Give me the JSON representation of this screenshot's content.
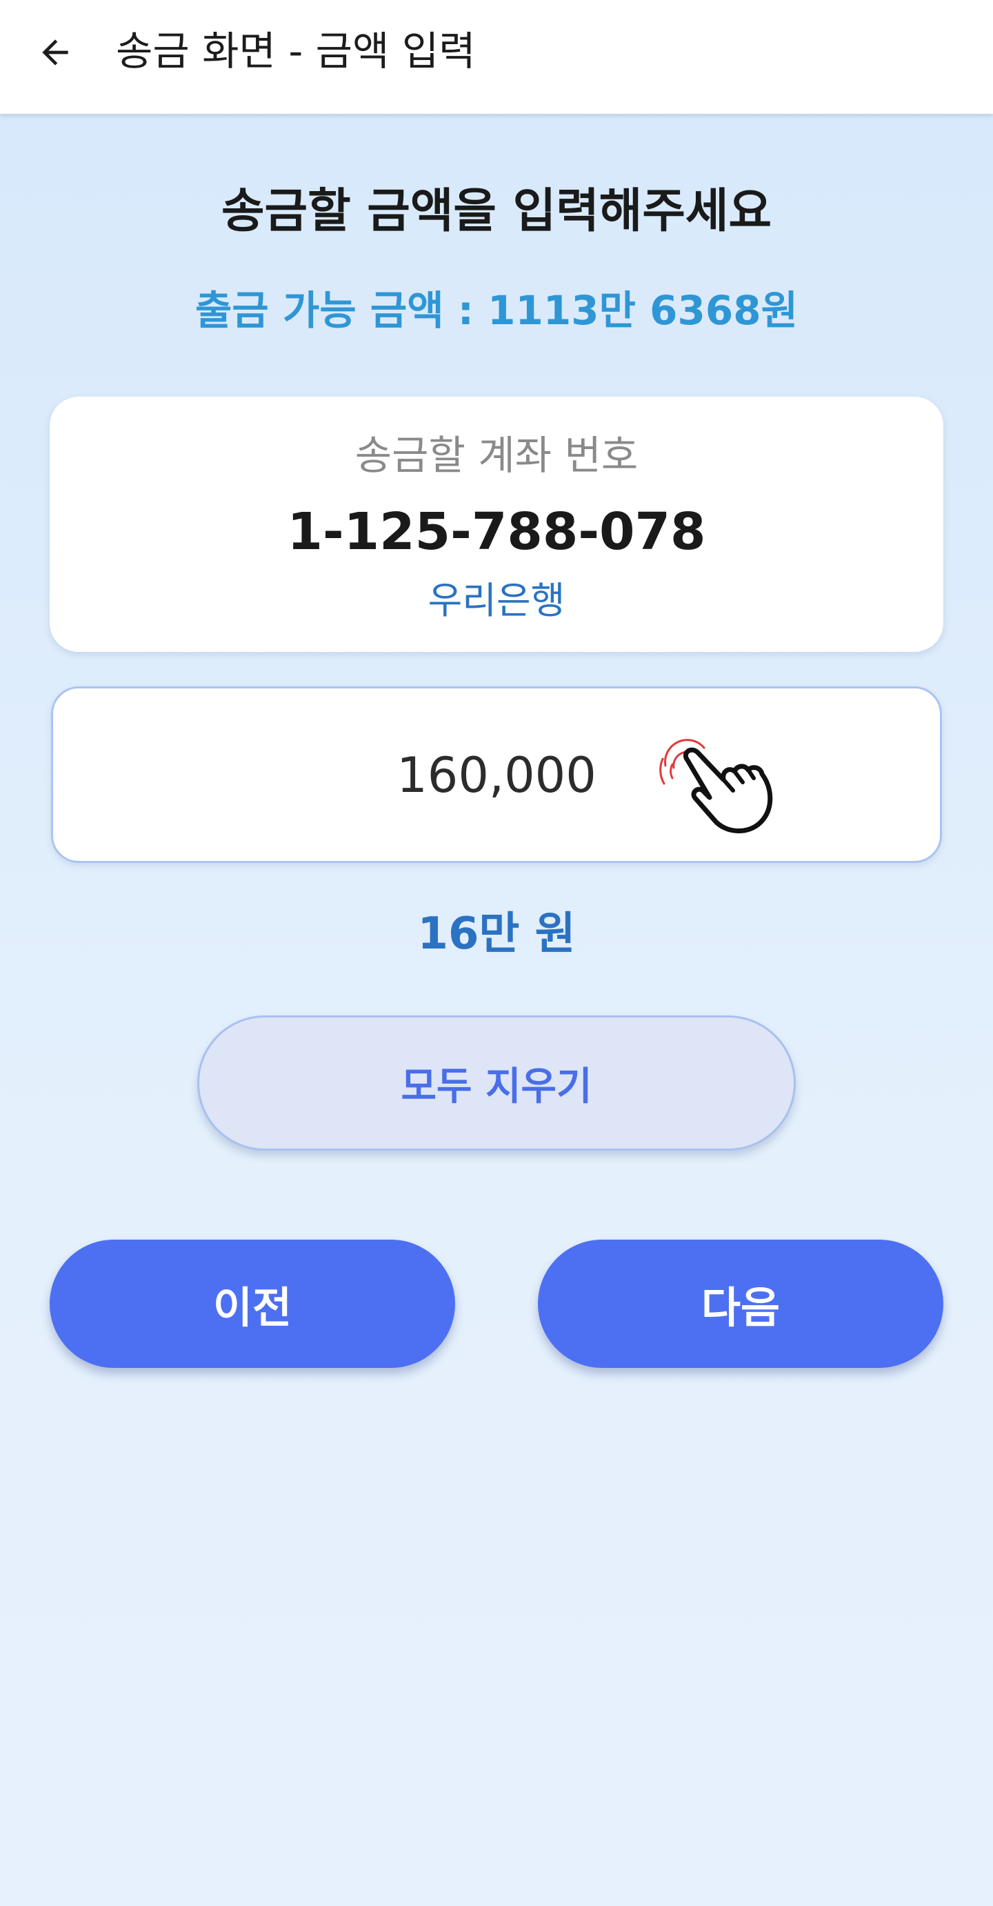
{
  "app_bar": {
    "back_icon": "arrow-left-icon",
    "title": "송금 화면 - 금액 입력"
  },
  "main": {
    "headline": "송금할 금액을 입력해주세요",
    "balance_text": "출금 가능 금액 : 1113만 6368원",
    "account": {
      "label": "송금할 계좌 번호",
      "number": "1-125-788-078",
      "bank": "우리은행"
    },
    "amount": {
      "value": "160,000",
      "korean": "16만 원",
      "tap_icon": "tap-hand-icon"
    },
    "clear_label": "모두 지우기",
    "prev_label": "이전",
    "next_label": "다음"
  },
  "colors": {
    "accent": "#4d70f2",
    "balance_text": "#2f96d6",
    "bank_text": "#2a72c0",
    "clear_bg": "#dde5f7",
    "clear_text": "#4a6ee8",
    "background": "#d6e8fb"
  }
}
